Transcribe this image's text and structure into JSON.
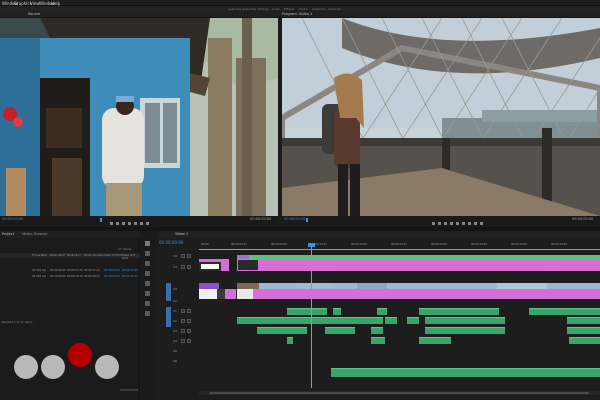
{
  "menu": [
    "Window",
    "Graphics",
    "View",
    "Window",
    "Help"
  ],
  "workspace_tabs": [
    "Learning",
    "Assembly",
    "Editing",
    "Color",
    "Effects",
    "Audio",
    "Graphics",
    "Libraries"
  ],
  "source_panel": {
    "tab": "Source",
    "timecode_left": "00:00:00:00",
    "timecode_right": "00:00:00:00"
  },
  "program_panel": {
    "tab": "Program: Video 1",
    "timecode_left": "00:00:00:00",
    "timecode_right": "00:00:00:00"
  },
  "project_panel": {
    "tabs": [
      "Project",
      "Media Browser"
    ],
    "item_count": "17 Items",
    "columns": [
      "Frame Rate",
      "Media Start",
      "Media End",
      "Media Duration",
      "Video In Point",
      "Video Out Point"
    ],
    "rows": [
      [
        "23.976 fps",
        "00:00:00:00",
        "00:00:27:21",
        "00:00:27:22",
        "00:00:00:00",
        "00:00:27:21"
      ],
      [
        "23.976 fps",
        "00:00:00:00",
        "00:00:19:11",
        "00:00:19:12",
        "00:00:00:00",
        "00:00:19:11"
      ]
    ],
    "status": "Selected 1 of 17 items"
  },
  "timeline": {
    "tab": "Video 1",
    "timecode": "00:00:00:00",
    "ruler": [
      "00:00",
      "00:00:04:23",
      "00:00:09:23",
      "00:00:14:23",
      "00:00:19:23",
      "00:00:24:23",
      "00:00:29:23",
      "00:00:34:23",
      "00:00:39:23",
      "00:00:44:23"
    ],
    "video_tracks": [
      "V4",
      "V3",
      "V2",
      "V1"
    ],
    "audio_tracks": [
      "A1",
      "A2",
      "A3",
      "A4",
      "A5",
      "A6"
    ]
  },
  "colors": {
    "accent_blue": "#3f8fd8",
    "clip_pink": "#d46fd8",
    "clip_purple": "#8a52c9",
    "clip_green": "#3aa56b",
    "playhead": "#6ba3e0",
    "record_red": "#b20000"
  }
}
